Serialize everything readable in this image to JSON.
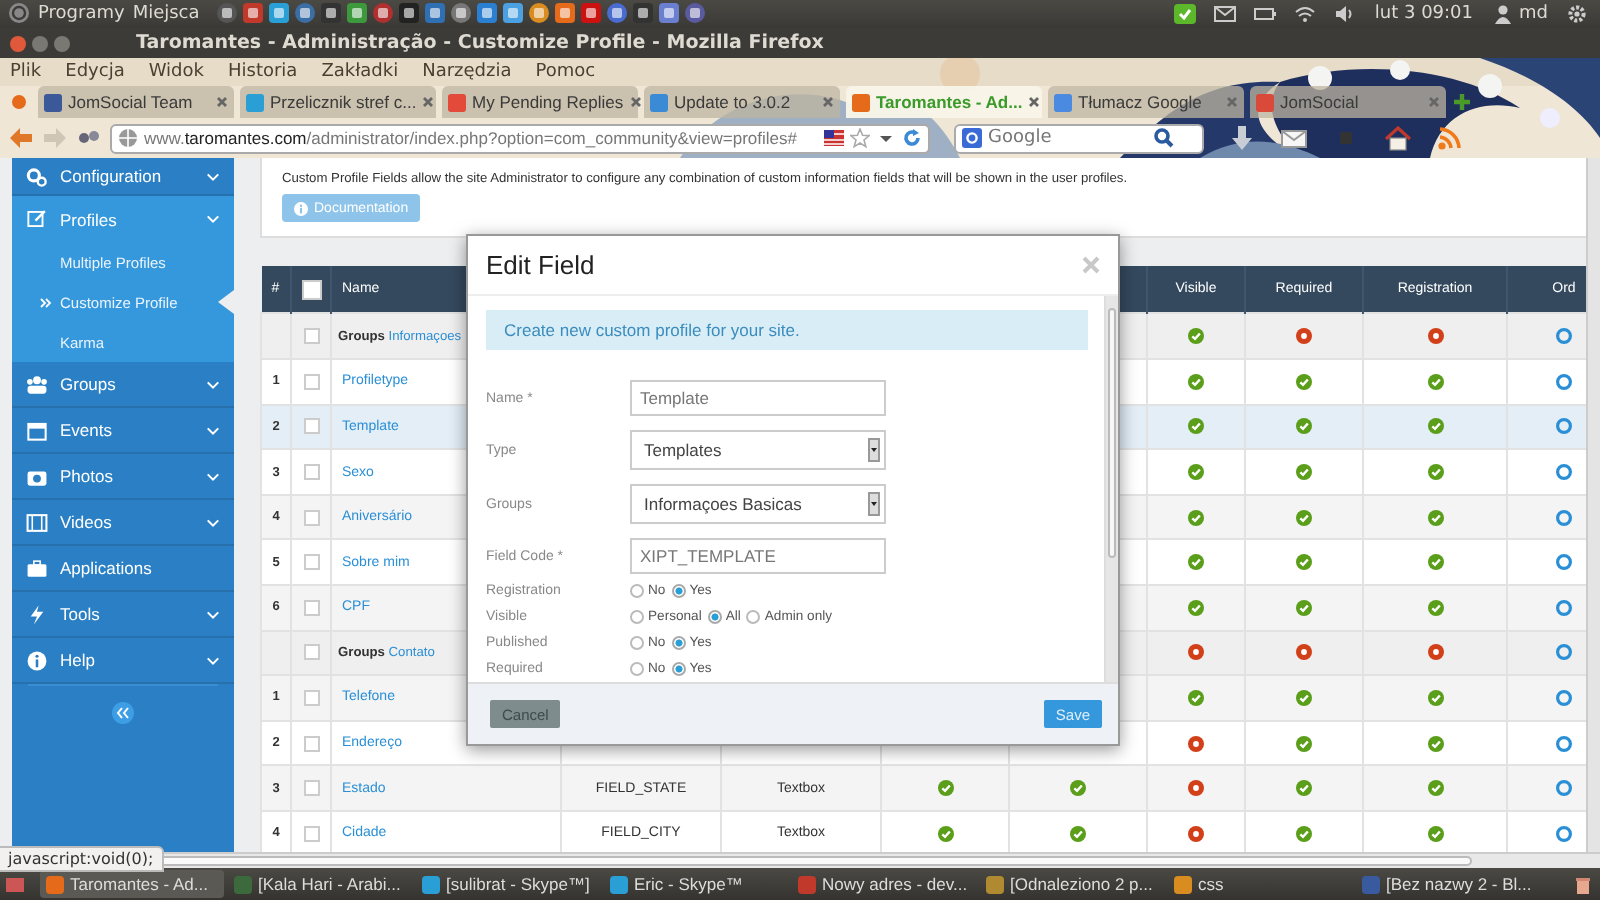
{
  "top_panel": {
    "menus": [
      "Programy",
      "Miejsca"
    ],
    "clock": "lut 3 09:01",
    "user": "md"
  },
  "window": {
    "title": "Taromantes - Administração - Customize Profile - Mozilla Firefox"
  },
  "menu_bar": [
    "Plik",
    "Edycja",
    "Widok",
    "Historia",
    "Zakładki",
    "Narzędzia",
    "Pomoc"
  ],
  "tabs": [
    {
      "label": "JomSocial Team",
      "selected": false
    },
    {
      "label": "Przelicznik stref c...",
      "selected": false
    },
    {
      "label": "My Pending Replies",
      "selected": false
    },
    {
      "label": "Update to 3.0.2",
      "selected": false
    },
    {
      "label": "Taromantes - Ad...",
      "selected": true
    },
    {
      "label": "Tłumacz Google",
      "selected": false
    },
    {
      "label": "JomSocial",
      "selected": false
    }
  ],
  "address_bar": {
    "url": "www.**taromantes.com**/administrator/index.php?option=com_community&view=profiles#"
  },
  "search": {
    "placeholder": "Google"
  },
  "sidebar": {
    "items": [
      {
        "label": "Configuration",
        "expandable": true,
        "expanded": false
      },
      {
        "label": "Profiles",
        "expandable": true,
        "expanded": true,
        "children": [
          {
            "label": "Multiple Profiles",
            "selected": false
          },
          {
            "label": "Customize Profile",
            "selected": true
          },
          {
            "label": "Karma",
            "selected": false
          }
        ]
      },
      {
        "label": "Groups",
        "expandable": true,
        "expanded": false
      },
      {
        "label": "Events",
        "expandable": true,
        "expanded": false
      },
      {
        "label": "Photos",
        "expandable": true,
        "expanded": false
      },
      {
        "label": "Videos",
        "expandable": true,
        "expanded": false
      },
      {
        "label": "Applications",
        "expandable": false,
        "expanded": false
      },
      {
        "label": "Tools",
        "expandable": true,
        "expanded": false
      },
      {
        "label": "Help",
        "expandable": true,
        "expanded": false
      }
    ]
  },
  "content": {
    "description": "Custom Profile Fields allow the site Administrator to configure any combination of custom information fields that will be shown in the user profiles.",
    "documentation_button": "Documentation"
  },
  "table": {
    "columns": [
      "#",
      "Name",
      "Visible",
      "Required",
      "Registration",
      "Ord"
    ],
    "header_checked": false,
    "rows": [
      {
        "kind": "group",
        "checked": false,
        "highlighted": false,
        "prefix": "Groups",
        "name": "Informaçoes",
        "visible": true,
        "required": false,
        "registration": false
      },
      {
        "kind": "field",
        "number": "1",
        "checked": false,
        "highlighted": false,
        "name": "Profiletype",
        "visible": true,
        "required": true,
        "registration": true
      },
      {
        "kind": "field",
        "number": "2",
        "checked": false,
        "highlighted": true,
        "name": "Template",
        "visible": true,
        "required": true,
        "registration": true
      },
      {
        "kind": "field",
        "number": "3",
        "checked": false,
        "highlighted": false,
        "name": "Sexo",
        "visible": true,
        "required": true,
        "registration": true
      },
      {
        "kind": "field",
        "number": "4",
        "checked": false,
        "highlighted": false,
        "name": "Aniversário",
        "visible": true,
        "required": true,
        "registration": true
      },
      {
        "kind": "field",
        "number": "5",
        "checked": false,
        "highlighted": false,
        "name": "Sobre mim",
        "visible": true,
        "required": true,
        "registration": true
      },
      {
        "kind": "field",
        "number": "6",
        "checked": false,
        "highlighted": false,
        "name": "CPF",
        "visible": true,
        "required": true,
        "registration": true
      },
      {
        "kind": "group",
        "checked": false,
        "highlighted": false,
        "prefix": "Groups",
        "name": "Contato",
        "visible": false,
        "required": false,
        "registration": false
      },
      {
        "kind": "field",
        "number": "1",
        "checked": false,
        "highlighted": false,
        "name": "Telefone",
        "visible": true,
        "required": true,
        "registration": true
      },
      {
        "kind": "field",
        "number": "2",
        "checked": false,
        "highlighted": false,
        "name": "Endereço",
        "visible": false,
        "required": true,
        "registration": true
      },
      {
        "kind": "field",
        "number": "3",
        "checked": false,
        "highlighted": false,
        "name": "Estado",
        "column_4": "FIELD_STATE",
        "column_5": "Textbox",
        "column_6": true,
        "column_7": true,
        "visible": false,
        "required": true,
        "registration": true
      },
      {
        "kind": "field",
        "number": "4",
        "checked": false,
        "highlighted": false,
        "name": "Cidade",
        "column_4": "FIELD_CITY",
        "column_5": "Textbox",
        "column_6": true,
        "column_7": true,
        "visible": false,
        "required": true,
        "registration": true
      }
    ]
  },
  "modal": {
    "title": "Edit Field",
    "alert": "Create new custom profile for your site.",
    "fields": [
      {
        "kind": "text",
        "label": "Name *",
        "value": "Template"
      },
      {
        "kind": "select",
        "label": "Type",
        "value": "Templates"
      },
      {
        "kind": "select",
        "label": "Groups",
        "value": "Informaçoes Basicas"
      },
      {
        "kind": "text",
        "label": "Field Code *",
        "value": "XIPT_TEMPLATE"
      },
      {
        "kind": "radio",
        "label": "Registration",
        "options": [
          {
            "label": "No",
            "selected": false
          },
          {
            "label": "Yes",
            "selected": true
          }
        ]
      },
      {
        "kind": "radio",
        "label": "Visible",
        "options": [
          {
            "label": "Personal",
            "selected": false
          },
          {
            "label": "All",
            "selected": true
          },
          {
            "label": "Admin only",
            "selected": false
          }
        ]
      },
      {
        "kind": "radio",
        "label": "Published",
        "options": [
          {
            "label": "No",
            "selected": false
          },
          {
            "label": "Yes",
            "selected": true
          }
        ]
      },
      {
        "kind": "radio",
        "label": "Required",
        "options": [
          {
            "label": "No",
            "selected": false
          },
          {
            "label": "Yes",
            "selected": true
          }
        ]
      }
    ],
    "buttons": [
      {
        "kind": "cancel",
        "label": "Cancel"
      },
      {
        "kind": "save",
        "label": "Save"
      }
    ]
  },
  "status_text": "javascript:void(0);",
  "taskbar": [
    "Taromantes - Ad...",
    "[Kala Hari - Arabi...",
    "[sulibrat - Skype™]",
    "Eric - Skype™",
    "Nowy adres - dev...",
    "[Odnaleziono 2 p...",
    "css",
    "[Bez nazwy 2 - Bl..."
  ]
}
